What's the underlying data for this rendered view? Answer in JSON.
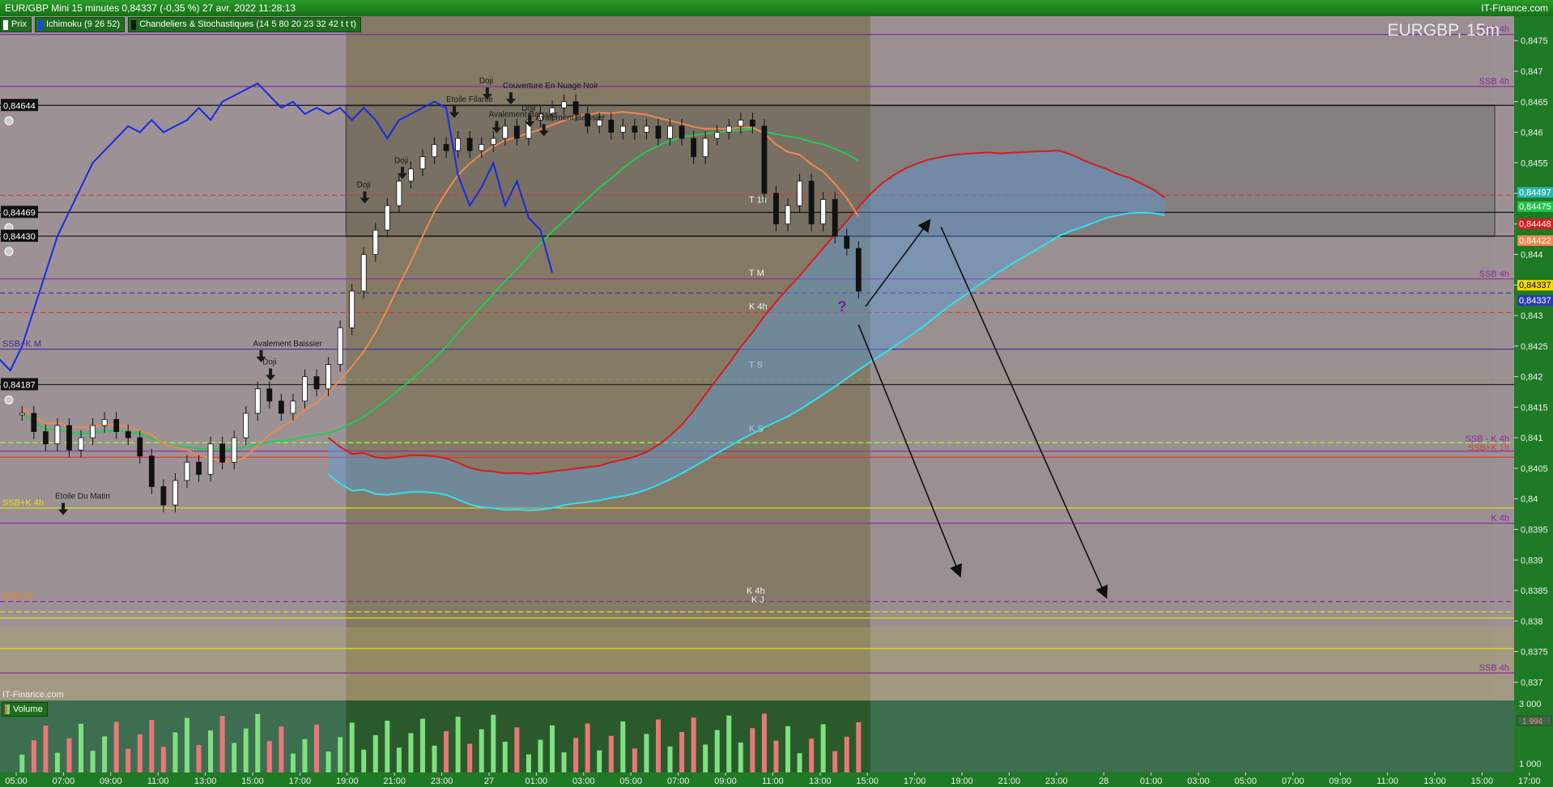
{
  "header": {
    "title": "EUR/GBP Mini 15 minutes 0,84337 (-0,35 %) 27 avr. 2022 11:28:13",
    "brand": "IT-Finance.com"
  },
  "legend": [
    {
      "label": "Prix",
      "color": "#ffffff"
    },
    {
      "label": "Ichimoku (9 26 52)",
      "color": "#2040ff"
    },
    {
      "label": "Chandeliers & Stochastiques (14 5 80 20 23 32 42 t t t)",
      "color": "#111111"
    }
  ],
  "symbol": "EURGBP, 15m",
  "watermark": "IT-Finance.com",
  "volume_panel": {
    "label": "Volume",
    "ticks": [
      "3 000",
      "1 000"
    ],
    "current_value": "1 994"
  },
  "price_axis": {
    "ticks": [
      "0,8475",
      "0,847",
      "0,8465",
      "0,846",
      "0,8455",
      "0,845",
      "0,8445",
      "0,844",
      "0,8435",
      "0,843",
      "0,8425",
      "0,842",
      "0,8415",
      "0,841",
      "0,8405",
      "0,84",
      "0,8395",
      "0,839",
      "0,8385",
      "0,838",
      "0,8375",
      "0,837"
    ],
    "markers": [
      {
        "text": "0,84497",
        "color": "#2ab7b0"
      },
      {
        "text": "0,84475",
        "color": "#22c24a"
      },
      {
        "text": "0,84448",
        "color": "#d81c1c"
      },
      {
        "text": "0,84422",
        "color": "#f08850"
      },
      {
        "text": "0,84337",
        "color": "#f5d800",
        "text_color": "#000000"
      },
      {
        "text": "0,84337",
        "color": "#2a3ab0"
      }
    ]
  },
  "time_axis": {
    "labels": [
      "05:00",
      "07:00",
      "09:00",
      "11:00",
      "13:00",
      "15:00",
      "17:00",
      "19:00",
      "21:00",
      "23:00",
      "27",
      "01:00",
      "03:00",
      "05:00",
      "07:00",
      "09:00",
      "11:00",
      "13:00",
      "15:00",
      "17:00",
      "19:00",
      "21:00",
      "23:00",
      "28",
      "01:00",
      "03:00",
      "05:00",
      "07:00",
      "09:00",
      "11:00",
      "13:00",
      "15:00",
      "17:00",
      "19:00"
    ]
  },
  "left_price_labels": [
    "0,84644",
    "0,84469",
    "0,84430",
    "0,84187"
  ],
  "level_labels": [
    {
      "text": "SSB 4h",
      "side": "right",
      "color": "#8a2aa0",
      "price": 0.8476
    },
    {
      "text": "SSB 4h",
      "side": "right",
      "color": "#8a2aa0",
      "price": 0.84675
    },
    {
      "text": "SSB 4h",
      "side": "right",
      "color": "#8a2aa0",
      "price": 0.8436
    },
    {
      "text": "SSB+K M",
      "side": "left",
      "color": "#3b2a9a",
      "price": 0.84245
    },
    {
      "text": "SSB - K 4h",
      "side": "right",
      "color": "#8a2aa0",
      "price": 0.8409
    },
    {
      "text": "SSB+K 1h",
      "side": "right",
      "color": "#d83a3a",
      "price": 0.84075
    },
    {
      "text": "SSB+K 4h",
      "side": "left",
      "color": "#e8e010",
      "price": 0.83985
    },
    {
      "text": "K 4h",
      "side": "right",
      "color": "#8a2aa0",
      "price": 0.8396
    },
    {
      "text": "SSB 4h",
      "side": "left",
      "color": "#e08a20",
      "price": 0.83832
    },
    {
      "text": "SSB 4h",
      "side": "right",
      "color": "#8a2aa0",
      "price": 0.83715
    }
  ],
  "cloud_labels": [
    "T 1h",
    "T M",
    "K 4h",
    "T S",
    "K S",
    "K 4h",
    "K J"
  ],
  "pattern_labels": [
    "Doji",
    "Couverture En Nuage Noir",
    "Etoile Filante",
    "Avalement Baissier",
    "Doji",
    "Doji",
    "Doji",
    "Avalement Baissier",
    "Doji",
    "Avalement Baissier",
    "Etoile Du Matin"
  ],
  "chart_data": {
    "type": "candlestick",
    "title": "EUR/GBP Mini 15 minutes",
    "ylim": [
      0.8367,
      0.8479
    ],
    "x_range_hours": [
      -24.25,
      38.5
    ],
    "last_price": 0.84337,
    "horizontal_levels": [
      {
        "price": 0.8476,
        "style": "solid",
        "color": "#8a2aa0"
      },
      {
        "price": 0.84675,
        "style": "solid",
        "color": "#8a2aa0"
      },
      {
        "price": 0.84644,
        "style": "solid",
        "color": "#111111"
      },
      {
        "price": 0.84497,
        "style": "dashed",
        "color": "#d83a3a"
      },
      {
        "price": 0.84469,
        "style": "solid",
        "color": "#111111"
      },
      {
        "price": 0.8443,
        "style": "solid",
        "color": "#111111"
      },
      {
        "price": 0.84337,
        "style": "dashed",
        "color": "#3b2a9a"
      },
      {
        "price": 0.8436,
        "style": "solid",
        "color": "#8a2aa0"
      },
      {
        "price": 0.84305,
        "style": "dashed",
        "color": "#d83a3a"
      },
      {
        "price": 0.84245,
        "style": "solid",
        "color": "#3b2a9a"
      },
      {
        "price": 0.84195,
        "style": "dashed",
        "color": "#8aa040"
      },
      {
        "price": 0.84187,
        "style": "solid",
        "color": "#222222"
      },
      {
        "price": 0.84092,
        "style": "dashed",
        "color": "#9aff40"
      },
      {
        "price": 0.84078,
        "style": "solid",
        "color": "#8a2aa0"
      },
      {
        "price": 0.84068,
        "style": "solid",
        "color": "#d83a3a"
      },
      {
        "price": 0.83985,
        "style": "solid",
        "color": "#e8e010"
      },
      {
        "price": 0.8396,
        "style": "solid",
        "color": "#8a2aa0"
      },
      {
        "price": 0.83832,
        "style": "dashed",
        "color": "#8a2aa0"
      },
      {
        "price": 0.83815,
        "style": "dashed",
        "color": "#e8e010"
      },
      {
        "price": 0.83805,
        "style": "solid",
        "color": "#e8e010"
      },
      {
        "price": 0.83755,
        "style": "solid",
        "color": "#e8e010"
      },
      {
        "price": 0.83715,
        "style": "solid",
        "color": "#8a2aa0"
      }
    ],
    "rectangle": {
      "t0": -10.25,
      "t1": 38.5,
      "price_top": 0.84644,
      "price_bottom": 0.8443
    },
    "sessions": [
      {
        "t0": -10.25,
        "t1": 12.0,
        "kind": "day"
      },
      {
        "t0": 12.0,
        "t1": 38.5,
        "kind": "night"
      }
    ],
    "candles_close": [
      [
        -24.0,
        0.8414
      ],
      [
        -23.5,
        0.8411
      ],
      [
        -23.0,
        0.8409
      ],
      [
        -22.5,
        0.8412
      ],
      [
        -22.0,
        0.8408
      ],
      [
        -21.5,
        0.841
      ],
      [
        -21.0,
        0.8412
      ],
      [
        -20.5,
        0.8413
      ],
      [
        -20.0,
        0.8411
      ],
      [
        -19.5,
        0.841
      ],
      [
        -19.0,
        0.8407
      ],
      [
        -18.5,
        0.8402
      ],
      [
        -18.0,
        0.8399
      ],
      [
        -17.5,
        0.8403
      ],
      [
        -17.0,
        0.8406
      ],
      [
        -16.5,
        0.8404
      ],
      [
        -16.0,
        0.8409
      ],
      [
        -15.5,
        0.8406
      ],
      [
        -15.0,
        0.841
      ],
      [
        -14.5,
        0.8414
      ],
      [
        -14.0,
        0.8418
      ],
      [
        -13.5,
        0.8416
      ],
      [
        -13.0,
        0.8414
      ],
      [
        -12.5,
        0.8416
      ],
      [
        -12.0,
        0.842
      ],
      [
        -11.5,
        0.8418
      ],
      [
        -11.0,
        0.8422
      ],
      [
        -10.5,
        0.8428
      ],
      [
        -10.0,
        0.8434
      ],
      [
        -9.5,
        0.844
      ],
      [
        -9.0,
        0.8444
      ],
      [
        -8.5,
        0.8448
      ],
      [
        -8.0,
        0.8452
      ],
      [
        -7.5,
        0.8454
      ],
      [
        -7.0,
        0.8456
      ],
      [
        -6.5,
        0.8458
      ],
      [
        -6.0,
        0.8457
      ],
      [
        -5.5,
        0.8459
      ],
      [
        -5.0,
        0.8457
      ],
      [
        -4.5,
        0.8458
      ],
      [
        -4.0,
        0.8459
      ],
      [
        -3.5,
        0.8461
      ],
      [
        -3.0,
        0.8459
      ],
      [
        -2.5,
        0.8462
      ],
      [
        -2.0,
        0.8463
      ],
      [
        -1.5,
        0.8464
      ],
      [
        -1.0,
        0.8465
      ],
      [
        -0.5,
        0.8463
      ],
      [
        0.0,
        0.8461
      ],
      [
        0.5,
        0.8462
      ],
      [
        1.0,
        0.846
      ],
      [
        1.5,
        0.8461
      ],
      [
        2.0,
        0.846
      ],
      [
        2.5,
        0.8461
      ],
      [
        3.0,
        0.8459
      ],
      [
        3.5,
        0.8461
      ],
      [
        4.0,
        0.8459
      ],
      [
        4.5,
        0.8456
      ],
      [
        5.0,
        0.8459
      ],
      [
        5.5,
        0.846
      ],
      [
        6.0,
        0.8461
      ],
      [
        6.5,
        0.8462
      ],
      [
        7.0,
        0.8461
      ],
      [
        7.5,
        0.845
      ],
      [
        8.0,
        0.8445
      ],
      [
        8.5,
        0.8448
      ],
      [
        9.0,
        0.8452
      ],
      [
        9.5,
        0.8445
      ],
      [
        10.0,
        0.8449
      ],
      [
        10.5,
        0.8443
      ],
      [
        11.0,
        0.8441
      ],
      [
        11.5,
        0.8434
      ]
    ],
    "ichimoku": {
      "tenkan_color": "#f08850",
      "kijun_color": "#22cc55",
      "chikou_color": "#1a2ae0",
      "ssa_color": "#d81c1c",
      "ssb_color": "#30e0f0",
      "cloud_fill": "#5a9ad8"
    },
    "annotation_arrows": [
      {
        "from": [
          11.8,
          0.84315
        ],
        "to": [
          14.5,
          0.84455
        ]
      },
      {
        "from": [
          11.5,
          0.84285
        ],
        "to": [
          15.8,
          0.83875
        ]
      },
      {
        "from": [
          15.0,
          0.84445
        ],
        "to": [
          22.0,
          0.8384
        ]
      }
    ],
    "question_mark": {
      "t": 10.75,
      "price": 0.84315,
      "text": "?"
    },
    "volume": {
      "ymax": 3400
    }
  }
}
